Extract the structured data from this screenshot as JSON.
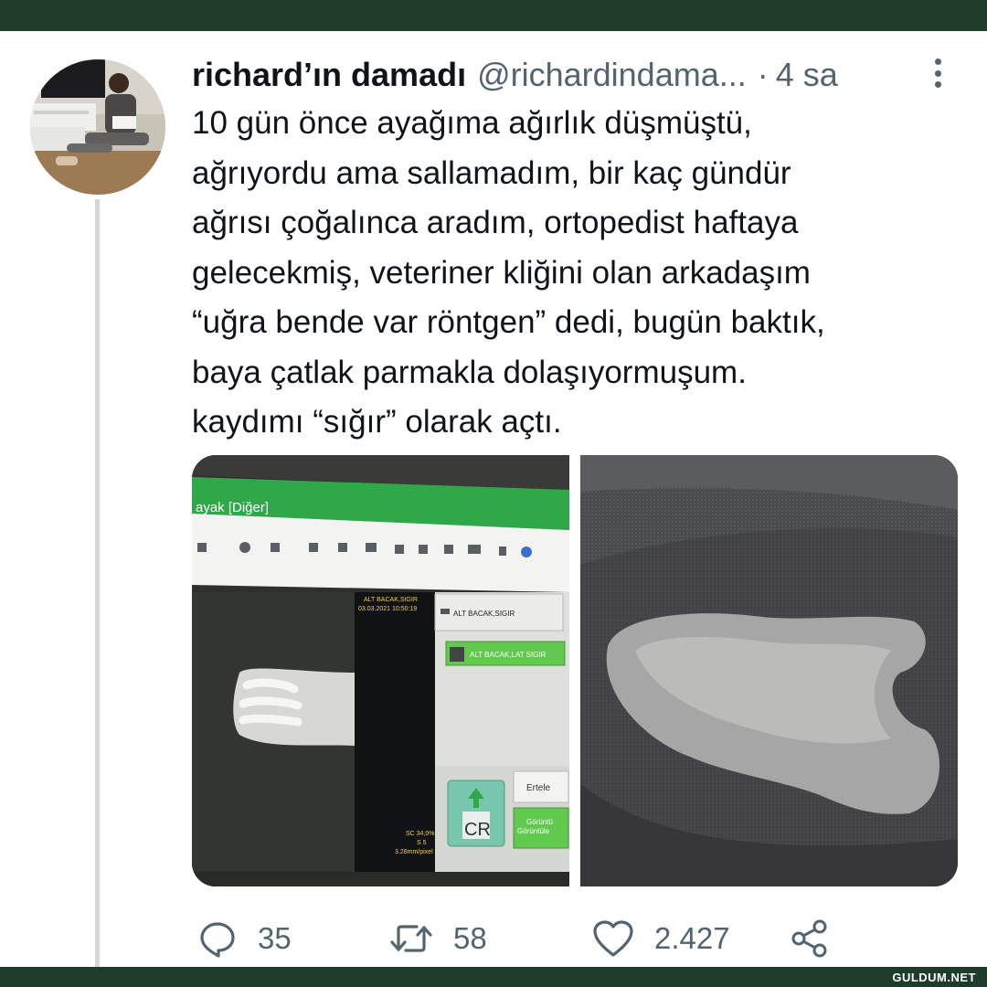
{
  "tweet": {
    "display_name": "richard’ın damadı",
    "handle": "@richardindama...",
    "separator": "·",
    "time": "4 sa",
    "text_lines": [
      "10 gün önce ayağıma ağırlık düşmüştü,",
      "ağrıyordu ama sallamadım, bir kaç gündür",
      "ağrısı çoğalınca aradım, ortopedist haftaya",
      "gelecekmiş, veteriner kliğini olan arkadaşım",
      "“uğra bende var röntgen” dedi, bugün baktık,",
      "baya çatlak parmakla dolaşıyormuşum.",
      "kaydımı “sığır” olarak açtı."
    ]
  },
  "media": {
    "left_photo": {
      "window_title": "ayak [Diğer]",
      "panel_header_lines": [
        "ALT BACAK,SIGIR",
        "03.03.2021 10:50:19"
      ],
      "list_items": [
        "ALT BACAK,SIGIR",
        "ALT BACAK,LAT SIGIR"
      ],
      "cr_badge": "CR",
      "next_button": "Ertele",
      "view_button_lines": [
        "Görüntü",
        "Görüntüle"
      ],
      "scale_lines": [
        "SC 34,0%",
        "S 5",
        "3.28mm/pixel"
      ]
    }
  },
  "actions": {
    "reply_count": "35",
    "retweet_count": "58",
    "like_count": "2.427"
  },
  "watermark": "GULDUM.NET",
  "colors": {
    "frame": "#1f3b2a",
    "text": "#0f1419",
    "secondary": "#536471",
    "thread_line": "#d3d7da",
    "software_green": "#2fa84a"
  },
  "icons": [
    "more-vertical-icon",
    "reply-icon",
    "retweet-icon",
    "like-icon",
    "share-icon"
  ]
}
